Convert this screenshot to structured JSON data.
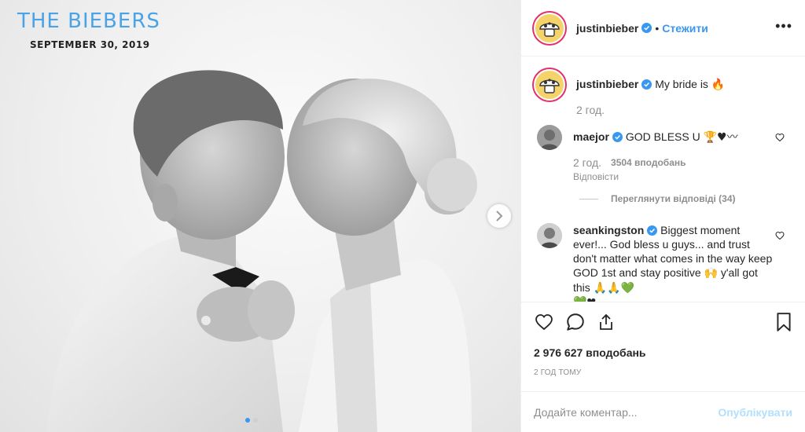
{
  "photo": {
    "title": "THE BIEBERS",
    "date": "SEPTEMBER 30, 2019"
  },
  "header": {
    "username": "justinbieber",
    "separator": "•",
    "follow_label": "Стежити",
    "more_label": "•••"
  },
  "caption": {
    "username": "justinbieber",
    "text": "My bride is",
    "emoji": "🔥",
    "time": "2 год."
  },
  "comments": [
    {
      "username": "maejor",
      "text": "GOD BLESS U",
      "emoji": "🏆♥〰",
      "time": "2 год.",
      "likes": "3504 вподобань",
      "reply_label": "Відповісти",
      "view_replies": "Переглянути відповіді (34)"
    },
    {
      "username": "seankingston",
      "text": "Biggest moment ever!... God bless u guys... and trust don't matter what comes in the way keep GOD 1st and stay positive",
      "emoji_mid": "🙌",
      "text2": "y'all got this",
      "emoji_end": "🙏🙏💚",
      "emoji_line2": "💚❤"
    }
  ],
  "post": {
    "likes": "2 976 627 вподобань",
    "time_ago": "2 ГОД ТОМУ"
  },
  "add_comment": {
    "placeholder": "Додайте коментар...",
    "post_label": "Опублікувати"
  },
  "colors": {
    "link": "#3897f0",
    "post_disabled": "#b2dffc",
    "title_blue": "#4aa3e6"
  }
}
